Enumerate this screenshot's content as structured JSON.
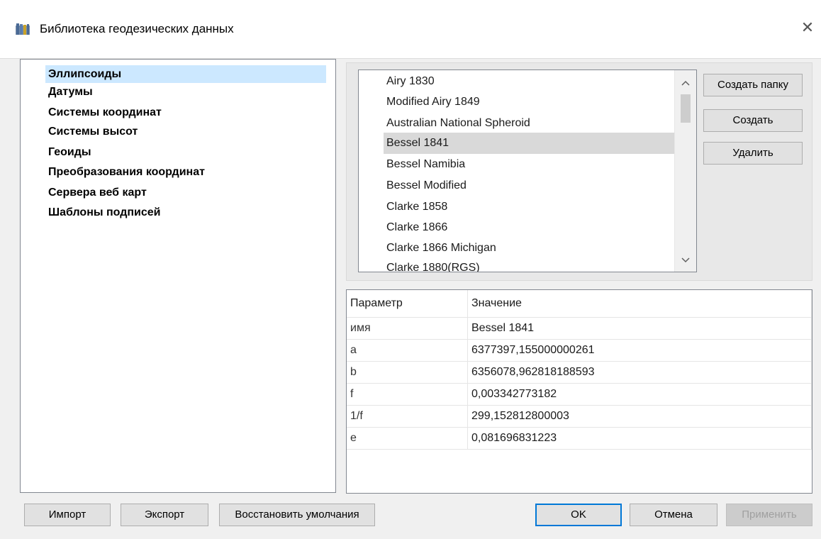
{
  "window": {
    "title": "Библиотека геодезических данных",
    "close_icon": "close-icon"
  },
  "tree": {
    "items": [
      {
        "label": "Эллипсоиды",
        "selected": true
      },
      {
        "label": "Датумы"
      },
      {
        "label": "Системы координат"
      },
      {
        "label": "Системы высот"
      },
      {
        "label": "Геоиды"
      },
      {
        "label": "Преобразования координат"
      },
      {
        "label": "Сервера веб карт"
      },
      {
        "label": "Шаблоны подписей"
      }
    ]
  },
  "list": {
    "items": [
      "Airy 1830",
      "Modified Airy 1849",
      "Australian National Spheroid",
      "Bessel 1841",
      "Bessel Namibia",
      "Bessel Modified",
      "Clarke 1858",
      "Clarke 1866",
      "Clarke 1866 Michigan",
      "Clarke 1880(RGS)"
    ],
    "selected": "Bessel 1841"
  },
  "side_buttons": {
    "create_folder": "Создать папку",
    "create": "Создать",
    "delete": "Удалить"
  },
  "props": {
    "header": {
      "param": "Параметр",
      "value": "Значение"
    },
    "rows": [
      {
        "param": "имя",
        "value": "Bessel 1841"
      },
      {
        "param": "a",
        "value": "6377397,155000000261"
      },
      {
        "param": "b",
        "value": "6356078,962818188593"
      },
      {
        "param": "f",
        "value": "0,003342773182"
      },
      {
        "param": "1/f",
        "value": "299,152812800003"
      },
      {
        "param": "e",
        "value": "0,081696831223"
      }
    ]
  },
  "footer": {
    "import": "Импорт",
    "export": "Экспорт",
    "restore": "Восстановить умолчания",
    "ok": "OK",
    "cancel": "Отмена",
    "apply": "Применить"
  }
}
